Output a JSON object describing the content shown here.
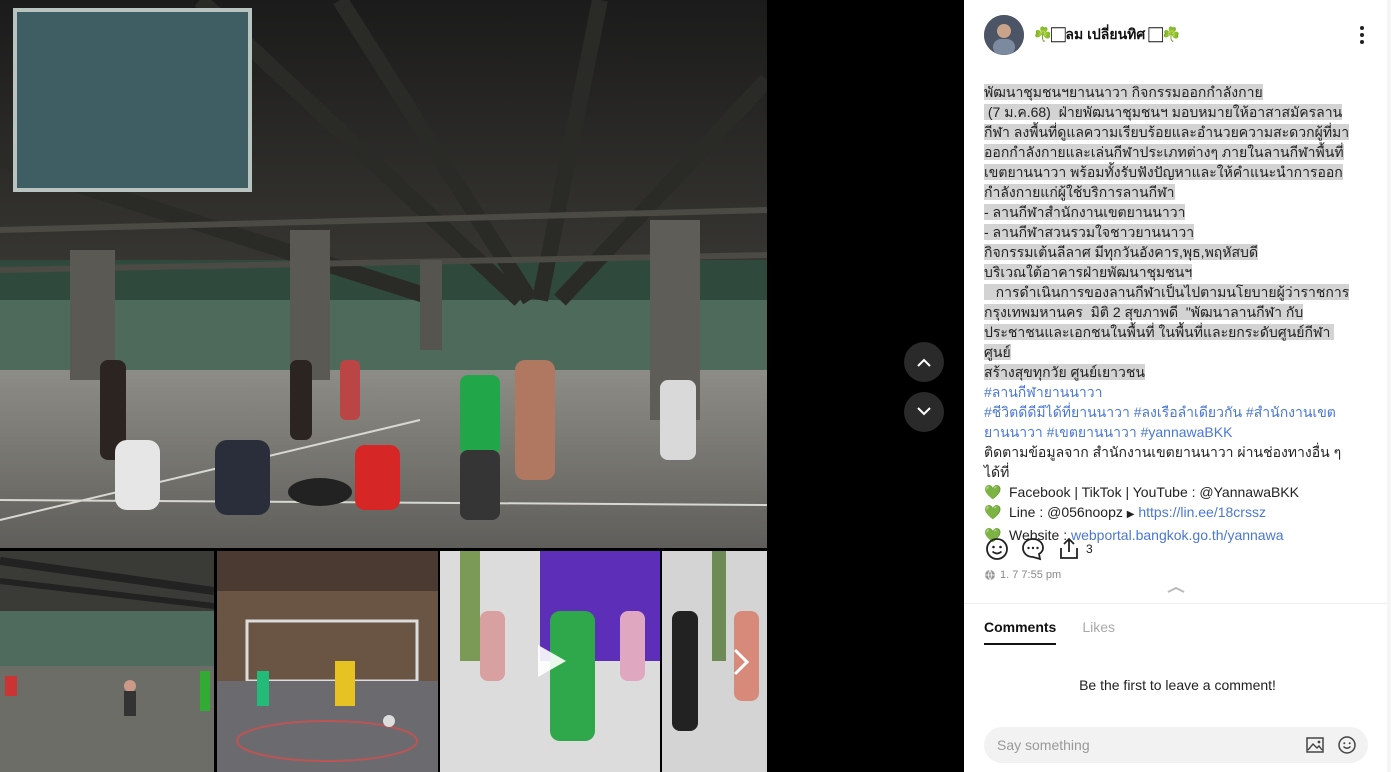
{
  "post": {
    "author": "☘️🏻ลม เปลี่ยนทิศ 🏻☘️",
    "lines": [
      "พัฒนาชุมชนฯยานนาวา กิจกรรมออกกำลังกาย",
      " (7 ม.ค.68)  ฝ่ายพัฒนาชุมชนฯ มอบหมายให้อาสาสมัครลาน",
      "กีฬา ลงพื้นที่ดูแลความเรียบร้อยและอำนวยความสะดวกผู้ที่มา",
      "ออกกำลังกายและเล่นกีฬาประเภทต่างๆ ภายในลานกีฬาพื้นที่",
      "เขตยานนาวา พร้อมทั้งรับฟังปัญหาและให้คำแนะนำการออก",
      "กำลังกายแก่ผู้ใช้บริการลานกีฬา",
      "- ลานกีฬาสำนักงานเขตยานนาวา",
      "- ลานกีฬาสวนรวมใจชาวยานนาวา",
      "กิจกรรมเต้นลีลาศ มีทุกวันอังคาร,พุธ,พฤหัสบดี",
      "บริเวณใต้อาคารฝ่ายพัฒนาชุมชนฯ",
      "   การดำเนินการของลานกีฬาเป็นไปตามนโยบายผู้ว่าราชการ",
      "กรุงเทพมหานคร  มิติ 2 สุขภาพดี  \"พัฒนาลานกีฬา กับ",
      "ประชาชนและเอกชนในพื้นที่ ในพื้นที่และยกระดับศูนย์กีฬา ศูนย์",
      "สร้างสุขทุกวัย ศูนย์เยาวชน"
    ],
    "hashtag_line1": "#ลานกีฬายานนาวา",
    "hashtag_line2": "#ชีวิตดีดีมีได้ที่ยานนาวา #ลงเรือลำเดียวกัน #สำนักงานเขต",
    "hashtag_line3": "ยานนาวา #เขตยานนาวา #yannawaBKK",
    "follow_line1": "ติดตามข้อมูลจาก สำนักงานเขตยานนาวา ผ่านช่องทางอื่น ๆ",
    "follow_line2": "ได้ที่",
    "social_text": "Facebook | TikTok | YouTube : @YannawaBKK",
    "line_prefix": "Line : @056noopz ",
    "line_arrow": "▶",
    "line_url": "https://lin.ee/18crssz",
    "website_prefix": "Website : ",
    "website_url": "webportal.bangkok.go.th/yannawa",
    "heart_glyph": "💚",
    "share_count": "3",
    "timestamp": "1. 7 7:55 pm"
  },
  "comments": {
    "tab_comments": "Comments",
    "tab_likes": "Likes",
    "empty_text": "Be the first to leave a comment!",
    "input_placeholder": "Say something"
  },
  "colors": {
    "link": "#4a77d4",
    "heart": "#1fc76a",
    "highlight": "#d3d3d3"
  }
}
